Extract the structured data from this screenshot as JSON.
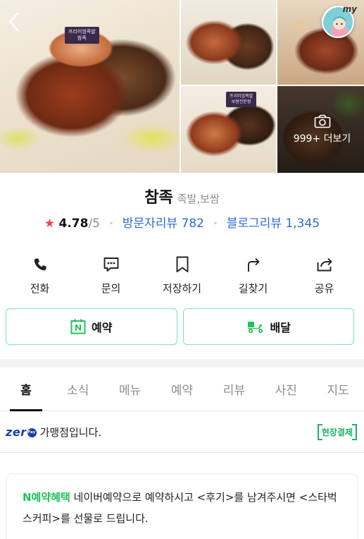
{
  "header": {
    "back_icon": "chevron-left-icon",
    "my_label": "my",
    "more_photos": "999+ 더보기",
    "menu_card_1": "프리미엄족발\n참족",
    "menu_card_2": "프리미엄쪽발\n보쌈전문점"
  },
  "place": {
    "name": "참족",
    "category": "족발,보쌈",
    "rating": "4.78",
    "rating_max": "/5",
    "visitor_reviews": "방문자리뷰 782",
    "blog_reviews": "블로그리뷰 1,345"
  },
  "actions": [
    {
      "label": "전화",
      "icon": "phone-icon"
    },
    {
      "label": "문의",
      "icon": "chat-icon"
    },
    {
      "label": "저장하기",
      "icon": "bookmark-icon"
    },
    {
      "label": "길찾기",
      "icon": "directions-icon"
    },
    {
      "label": "공유",
      "icon": "share-icon"
    }
  ],
  "buttons": {
    "reserve": "예약",
    "delivery": "배달"
  },
  "tabs": [
    "홈",
    "소식",
    "메뉴",
    "예약",
    "리뷰",
    "사진",
    "지도"
  ],
  "zero": {
    "logo": "zer",
    "pay": "Pay",
    "text": "가맹점입니다.",
    "badge": "현장결제"
  },
  "promo": {
    "highlight": "N예약혜택",
    "text": " 네이버예약으로 예약하시고 <후기>를 남겨주시면 <스타벅스커피>를 선물로 드립니다."
  },
  "colors": {
    "accent_green": "#1ec45a",
    "link_blue": "#2f6bd6",
    "star_red": "#f0424a",
    "zero_blue": "#1b3faa"
  }
}
